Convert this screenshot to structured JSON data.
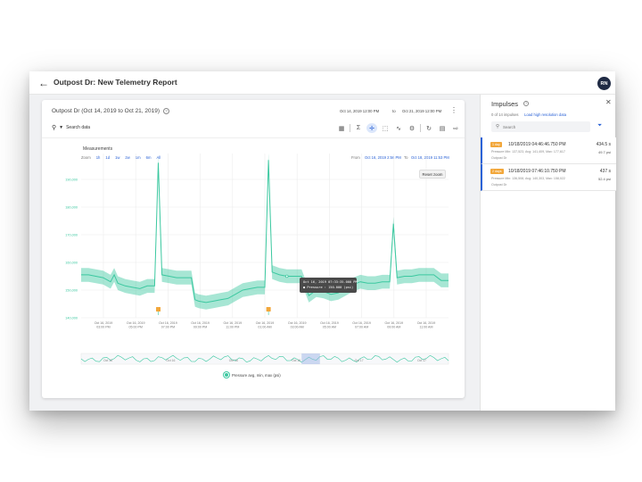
{
  "header": {
    "back_icon": "arrow-left-icon",
    "title": "Outpost Dr: New Telemetry Report",
    "avatar_initials": "RN"
  },
  "card": {
    "title": "Outpost Dr (Oct 14, 2019 to Oct 21, 2019)",
    "range_from": "Oct 14, 2019 12:00 PM",
    "range_to_label": "to",
    "range_to": "Oct 21, 2019 12:00 PM",
    "search_label": "Search data",
    "toolbar_icons": [
      "table-icon",
      "sigma-icon",
      "crosshair-icon",
      "select-icon",
      "trend-icon",
      "settings-icon",
      "refresh-icon",
      "save-icon",
      "export-icon"
    ],
    "active_tool": "crosshair-icon"
  },
  "measurements": {
    "label": "Measurements",
    "zoom_label": "Zoom",
    "zoom_options": [
      "1h",
      "1d",
      "1w",
      "2w",
      "1m",
      "6m",
      "All"
    ],
    "from_label": "From",
    "from_value": "Oct 16, 2019 2:56 PM",
    "to_label": "To",
    "to_value": "Oct 18, 2019 11:53 PM",
    "reset_zoom": "Reset zoom"
  },
  "tooltip": {
    "line1": "Oct 16, 2019 07:33:35.000 PM",
    "line2": "● Pressure : 150.000 (psi)"
  },
  "chart_data": {
    "type": "line",
    "ylabel": "",
    "y_ticks": [
      "200,000",
      "190,000",
      "180,000",
      "170,000",
      "160,000",
      "150,000",
      "140,000"
    ],
    "ylim": [
      140000,
      200000
    ],
    "x_tick_labels": [
      [
        "Oct 16, 2019",
        "03:00 PM"
      ],
      [
        "Oct 16, 2019",
        "05:00 PM"
      ],
      [
        "Oct 16, 2019",
        "07:00 PM"
      ],
      [
        "Oct 16, 2019",
        "09:00 PM"
      ],
      [
        "Oct 16, 2019",
        "11:00 PM"
      ],
      [
        "Oct 16, 2019",
        "01:00 AM"
      ],
      [
        "Oct 16, 2019",
        "03:00 AM"
      ],
      [
        "Oct 16, 2019",
        "05:00 AM"
      ],
      [
        "Oct 16, 2019",
        "07:00 AM"
      ],
      [
        "Oct 16, 2019",
        "09:00 AM"
      ],
      [
        "Oct 16, 2019",
        "11:00 AM"
      ]
    ],
    "series": [
      {
        "name": "Pressure avg, min, max (psi)",
        "color": "#3cc8a0",
        "x": [
          0,
          2,
          4,
          6,
          8,
          9,
          10,
          12,
          14,
          16,
          18,
          20,
          21,
          22,
          24,
          26,
          28,
          30,
          31,
          32,
          34,
          36,
          38,
          40,
          42,
          44,
          46,
          48,
          50,
          51,
          52,
          54,
          56,
          58,
          60,
          62,
          64,
          66,
          68,
          70,
          72,
          74,
          76,
          78,
          80,
          82,
          84,
          85,
          86,
          88,
          90,
          92,
          94,
          96,
          98,
          100
        ],
        "values": [
          155500,
          155500,
          155000,
          154500,
          153000,
          155500,
          152500,
          151500,
          151000,
          150500,
          151500,
          151500,
          196000,
          155500,
          155000,
          154500,
          154500,
          154500,
          146500,
          146000,
          145500,
          146000,
          146500,
          147000,
          148500,
          150000,
          150500,
          151000,
          151000,
          197000,
          156500,
          155500,
          155000,
          155000,
          155000,
          148000,
          150000,
          149500,
          148500,
          149000,
          150500,
          152000,
          153000,
          152500,
          152500,
          153000,
          153000,
          174000,
          154500,
          155000,
          155000,
          155500,
          155500,
          155500,
          153500,
          153500
        ],
        "band_halfwidth": 2500
      }
    ],
    "event_markers_x": [
      21,
      51
    ],
    "grid": true,
    "legend_position": "bottom-center",
    "navigator_labels": [
      "Oct 16",
      "Oct 16",
      "Oct 16",
      "Oct 16",
      "Oct 17",
      "Oct 17"
    ]
  },
  "legend": {
    "series_label": "Pressure avg, min, max (psi)"
  },
  "impulses": {
    "title": "Impulses",
    "count_text": "0 of 14 impulses",
    "load_link": "Load high resolution data",
    "search_placeholder": "Search",
    "filter_icon": "filter-icon",
    "items": [
      {
        "badge": "1 day",
        "time": "10/18/2019 04:46:46.750 PM",
        "duration": "434.5 s",
        "stats": "Pressure Min: 137,523, Avg: 141,409, Max: 177,617",
        "value": "49.7 psi",
        "location": "Outpost Dr"
      },
      {
        "badge": "2 days",
        "time": "10/18/2019 07:46:10.750 PM",
        "duration": "437 s",
        "stats": "Pressure Min: 136,508, Avg: 140,303, Max: 158,022",
        "value": "52.4 psi",
        "location": "Outpost Dr"
      }
    ]
  }
}
